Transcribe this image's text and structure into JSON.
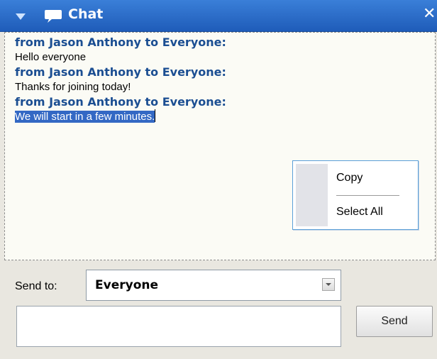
{
  "window": {
    "title": "Chat",
    "collapse_icon": "triangle-down-icon",
    "chat_icon": "speech-bubble-icon",
    "close_glyph": "✕"
  },
  "messages": [
    {
      "header": "from Jason Anthony to Everyone:",
      "text": "Hello everyone",
      "selected": false
    },
    {
      "header": "from Jason Anthony to Everyone:",
      "text": "Thanks for joining today!",
      "selected": false
    },
    {
      "header": "from Jason Anthony to Everyone:",
      "text": "We will start in a few minutes.",
      "selected": true
    }
  ],
  "context_menu": {
    "copy_label": "Copy",
    "select_all_label": "Select All"
  },
  "compose": {
    "send_to_label": "Send to:",
    "recipient_value": "Everyone",
    "message_value": "",
    "send_label": "Send"
  },
  "colors": {
    "titlebar": "#2a6fd0",
    "header_text": "#1b4e92",
    "selection": "#3368c4"
  }
}
